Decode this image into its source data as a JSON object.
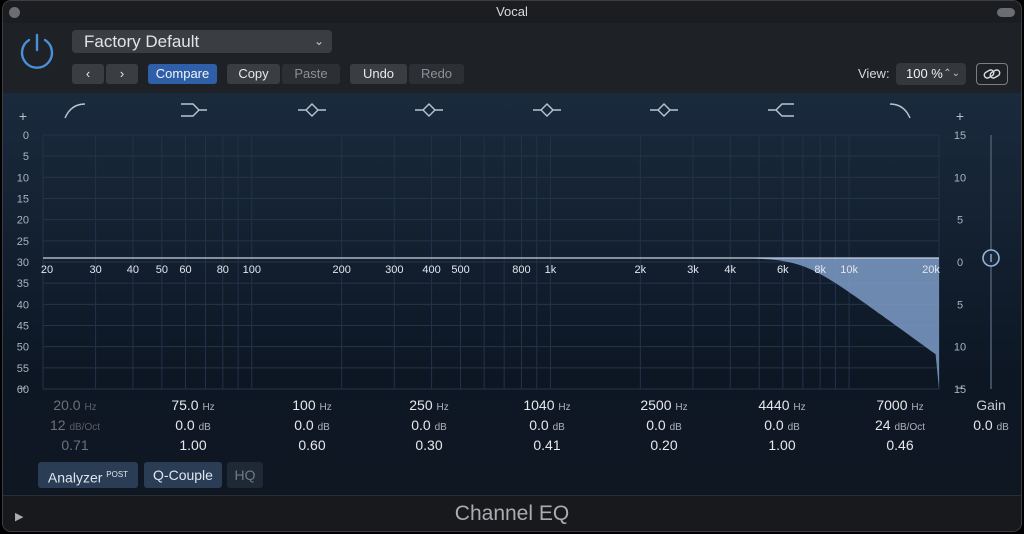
{
  "window": {
    "title": "Vocal"
  },
  "header": {
    "preset": "Factory Default",
    "compare": "Compare",
    "copy": "Copy",
    "paste": "Paste",
    "undo": "Undo",
    "redo": "Redo",
    "view_label": "View:",
    "view_value": "100 %"
  },
  "graph": {
    "db_left": [
      "0",
      "5",
      "10",
      "15",
      "20",
      "25",
      "30",
      "35",
      "40",
      "45",
      "50",
      "55",
      "60"
    ],
    "db_right": [
      "15",
      "10",
      "5",
      "0",
      "5",
      "10",
      "15"
    ],
    "freq_labels": [
      "20",
      "30",
      "40",
      "50",
      "60",
      "80",
      "100",
      "200",
      "300",
      "400",
      "500",
      "800",
      "1k",
      "2k",
      "3k",
      "4k",
      "6k",
      "8k",
      "10k",
      "20k"
    ],
    "plus_left": "+",
    "plus_right": "+",
    "minus_left": "−",
    "minus_right": "−"
  },
  "bands": [
    {
      "icon": "low-cut-icon",
      "freq": "20.0",
      "freq_unit": "Hz",
      "gain": "12",
      "gain_unit": "dB/Oct",
      "q": "0.71",
      "enabled": false
    },
    {
      "icon": "low-shelf-icon",
      "freq": "75.0",
      "freq_unit": "Hz",
      "gain": "0.0",
      "gain_unit": "dB",
      "q": "1.00",
      "enabled": true
    },
    {
      "icon": "bell-icon",
      "freq": "100",
      "freq_unit": "Hz",
      "gain": "0.0",
      "gain_unit": "dB",
      "q": "0.60",
      "enabled": true
    },
    {
      "icon": "bell-icon",
      "freq": "250",
      "freq_unit": "Hz",
      "gain": "0.0",
      "gain_unit": "dB",
      "q": "0.30",
      "enabled": true
    },
    {
      "icon": "bell-icon",
      "freq": "1040",
      "freq_unit": "Hz",
      "gain": "0.0",
      "gain_unit": "dB",
      "q": "0.41",
      "enabled": true
    },
    {
      "icon": "bell-icon",
      "freq": "2500",
      "freq_unit": "Hz",
      "gain": "0.0",
      "gain_unit": "dB",
      "q": "0.20",
      "enabled": true
    },
    {
      "icon": "high-shelf-icon",
      "freq": "4440",
      "freq_unit": "Hz",
      "gain": "0.0",
      "gain_unit": "dB",
      "q": "1.00",
      "enabled": true
    },
    {
      "icon": "high-cut-icon",
      "freq": "7000",
      "freq_unit": "Hz",
      "gain": "24",
      "gain_unit": "dB/Oct",
      "q": "0.46",
      "enabled": true
    }
  ],
  "gain": {
    "label": "Gain",
    "value": "0.0",
    "unit": "dB"
  },
  "buttons": {
    "analyzer": "Analyzer",
    "analyzer_sup": "POST",
    "q_couple": "Q-Couple",
    "hq": "HQ"
  },
  "footer": {
    "plugin_name": "Channel EQ"
  },
  "colors": {
    "accent": "#2e5fa8",
    "power": "#4a90d9",
    "curve_fill": "#7e9cc8"
  }
}
